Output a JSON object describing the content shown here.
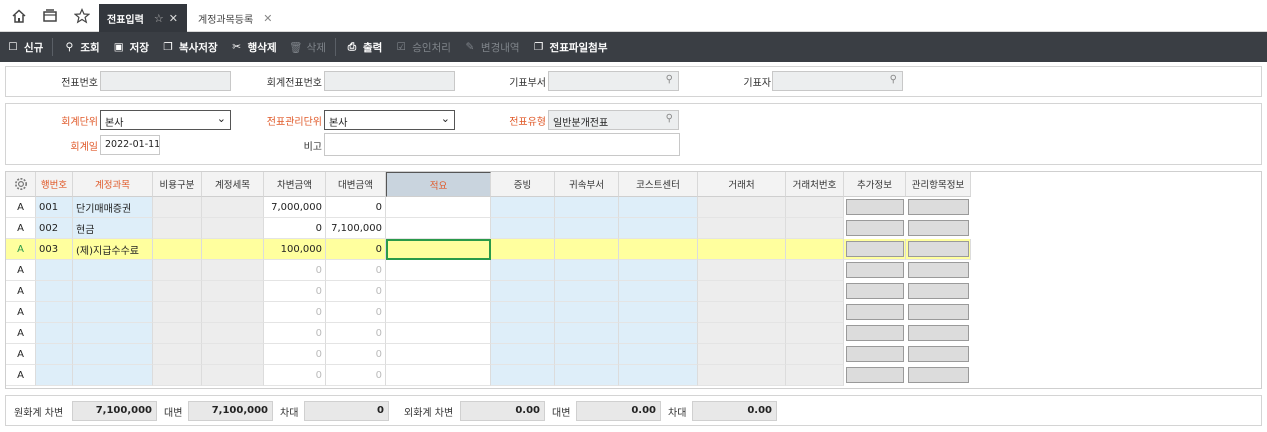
{
  "tabs": [
    {
      "label": "전표입력",
      "active": true
    },
    {
      "label": "계정과목등록",
      "active": false
    }
  ],
  "toolbar": [
    {
      "label": "신규",
      "icon": "new-icon",
      "enabled": true
    },
    {
      "label": "조회",
      "icon": "search-icon",
      "enabled": true
    },
    {
      "label": "저장",
      "icon": "save-icon",
      "enabled": true
    },
    {
      "label": "복사저장",
      "icon": "copy-save-icon",
      "enabled": true
    },
    {
      "label": "행삭제",
      "icon": "scissors-icon",
      "enabled": true
    },
    {
      "label": "삭제",
      "icon": "trash-icon",
      "enabled": false
    },
    {
      "label": "출력",
      "icon": "print-icon",
      "enabled": true
    },
    {
      "label": "승인처리",
      "icon": "approve-icon",
      "enabled": false
    },
    {
      "label": "변경내역",
      "icon": "edit-history-icon",
      "enabled": false
    },
    {
      "label": "전표파일첨부",
      "icon": "attach-icon",
      "enabled": true
    }
  ],
  "header": {
    "voucher_no_label": "전표번호",
    "voucher_no": "",
    "acct_voucher_no_label": "회계전표번호",
    "acct_voucher_no": "",
    "issue_dept_label": "기표부서",
    "issue_dept": "",
    "issuer_label": "기표자",
    "issuer": ""
  },
  "form": {
    "acct_unit_label": "회계단위",
    "acct_unit": "본사",
    "voucher_mgmt_unit_label": "전표관리단위",
    "voucher_mgmt_unit": "본사",
    "voucher_type_label": "전표유형",
    "voucher_type": "일반분개전표",
    "acct_date_label": "회계일",
    "acct_date": "2022-01-11",
    "remark_label": "비고",
    "remark": ""
  },
  "grid": {
    "columns": [
      "행번호",
      "계정과목",
      "비용구분",
      "계정세목",
      "차변금액",
      "대변금액",
      "적요",
      "증빙",
      "귀속부서",
      "코스트센터",
      "거래처",
      "거래처번호",
      "추가정보",
      "관리항목정보"
    ],
    "rows": [
      {
        "flag": "A",
        "no": "001",
        "account": "단기매매증권",
        "debit": "7,000,000",
        "credit": "0"
      },
      {
        "flag": "A",
        "no": "002",
        "account": "현금",
        "debit": "0",
        "credit": "7,100,000"
      },
      {
        "flag": "A",
        "no": "003",
        "account": "(제)지급수수료",
        "debit": "100,000",
        "credit": "0"
      },
      {
        "flag": "A",
        "no": "",
        "account": "",
        "debit": "0",
        "credit": "0"
      },
      {
        "flag": "A",
        "no": "",
        "account": "",
        "debit": "0",
        "credit": "0"
      },
      {
        "flag": "A",
        "no": "",
        "account": "",
        "debit": "0",
        "credit": "0"
      },
      {
        "flag": "A",
        "no": "",
        "account": "",
        "debit": "0",
        "credit": "0"
      },
      {
        "flag": "A",
        "no": "",
        "account": "",
        "debit": "0",
        "credit": "0"
      },
      {
        "flag": "A",
        "no": "",
        "account": "",
        "debit": "0",
        "credit": "0"
      }
    ]
  },
  "footer": {
    "krw_debit_label": "원화계 차변",
    "krw_debit": "7,100,000",
    "krw_credit_label": "대변",
    "krw_credit": "7,100,000",
    "krw_diff_label": "차대",
    "krw_diff": "0",
    "fx_debit_label": "외화계 차변",
    "fx_debit": "0.00",
    "fx_credit_label": "대변",
    "fx_credit": "0.00",
    "fx_diff_label": "차대",
    "fx_diff": "0.00"
  },
  "colors": {
    "accent_required": "#e05a2a",
    "selected_row": "#ffff9e",
    "editable_cell": "#deeef9",
    "toolbar_bg": "#3a3e44"
  }
}
